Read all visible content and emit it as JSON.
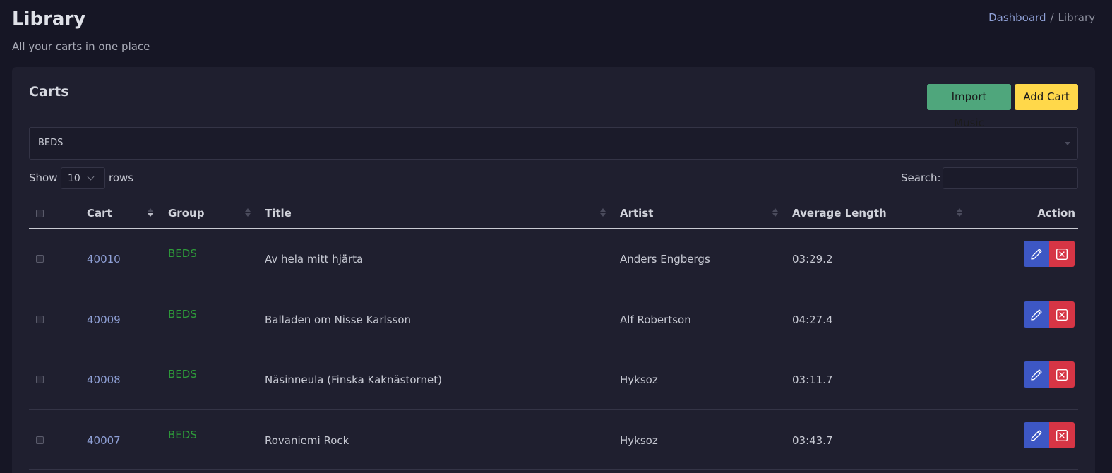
{
  "page": {
    "title": "Library",
    "subtitle": "All your carts in one place"
  },
  "breadcrumb": {
    "items": [
      "Dashboard",
      "Library"
    ],
    "separator": "/"
  },
  "card": {
    "title": "Carts",
    "buttons": {
      "import_label": "Import Music",
      "add_label": "Add Cart"
    },
    "group_filter": {
      "selected": "BEDS"
    },
    "length_menu": {
      "prefix": "Show",
      "value": "10",
      "suffix": "rows"
    },
    "search": {
      "label": "Search:",
      "value": ""
    }
  },
  "table": {
    "columns": [
      "Cart",
      "Group",
      "Title",
      "Artist",
      "Average Length",
      "Action"
    ],
    "rows": [
      {
        "cart": "40010",
        "group": "BEDS",
        "title": "Av hela mitt hjärta",
        "artist": "Anders Engbergs",
        "length": "03:29.2"
      },
      {
        "cart": "40009",
        "group": "BEDS",
        "title": "Balladen om Nisse Karlsson",
        "artist": "Alf Robertson",
        "length": "04:27.4"
      },
      {
        "cart": "40008",
        "group": "BEDS",
        "title": "Näsinneula (Finska Kaknästornet)",
        "artist": "Hyksoz",
        "length": "03:11.7"
      },
      {
        "cart": "40007",
        "group": "BEDS",
        "title": "Rovaniemi Rock",
        "artist": "Hyksoz",
        "length": "03:43.7"
      }
    ],
    "row_actions": [
      "pencil-icon",
      "x-square-icon"
    ]
  },
  "colors": {
    "background": "#161625",
    "card": "#1f1f2f",
    "link": "#8fa0d6",
    "group_green": "#2e9c3a",
    "import_button": "#4fa67c",
    "add_button": "#ffd84a",
    "edit_button": "#3d57c4",
    "delete_button": "#d63545"
  }
}
